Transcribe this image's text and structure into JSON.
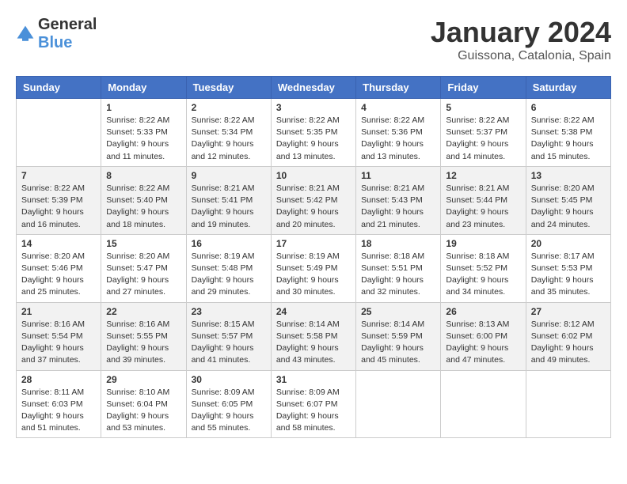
{
  "logo": {
    "text_general": "General",
    "text_blue": "Blue"
  },
  "title": "January 2024",
  "subtitle": "Guissona, Catalonia, Spain",
  "weekdays": [
    "Sunday",
    "Monday",
    "Tuesday",
    "Wednesday",
    "Thursday",
    "Friday",
    "Saturday"
  ],
  "weeks": [
    [
      {
        "day": "",
        "sunrise": "",
        "sunset": "",
        "daylight": ""
      },
      {
        "day": "1",
        "sunrise": "Sunrise: 8:22 AM",
        "sunset": "Sunset: 5:33 PM",
        "daylight": "Daylight: 9 hours and 11 minutes."
      },
      {
        "day": "2",
        "sunrise": "Sunrise: 8:22 AM",
        "sunset": "Sunset: 5:34 PM",
        "daylight": "Daylight: 9 hours and 12 minutes."
      },
      {
        "day": "3",
        "sunrise": "Sunrise: 8:22 AM",
        "sunset": "Sunset: 5:35 PM",
        "daylight": "Daylight: 9 hours and 13 minutes."
      },
      {
        "day": "4",
        "sunrise": "Sunrise: 8:22 AM",
        "sunset": "Sunset: 5:36 PM",
        "daylight": "Daylight: 9 hours and 13 minutes."
      },
      {
        "day": "5",
        "sunrise": "Sunrise: 8:22 AM",
        "sunset": "Sunset: 5:37 PM",
        "daylight": "Daylight: 9 hours and 14 minutes."
      },
      {
        "day": "6",
        "sunrise": "Sunrise: 8:22 AM",
        "sunset": "Sunset: 5:38 PM",
        "daylight": "Daylight: 9 hours and 15 minutes."
      }
    ],
    [
      {
        "day": "7",
        "sunrise": "Sunrise: 8:22 AM",
        "sunset": "Sunset: 5:39 PM",
        "daylight": "Daylight: 9 hours and 16 minutes."
      },
      {
        "day": "8",
        "sunrise": "Sunrise: 8:22 AM",
        "sunset": "Sunset: 5:40 PM",
        "daylight": "Daylight: 9 hours and 18 minutes."
      },
      {
        "day": "9",
        "sunrise": "Sunrise: 8:21 AM",
        "sunset": "Sunset: 5:41 PM",
        "daylight": "Daylight: 9 hours and 19 minutes."
      },
      {
        "day": "10",
        "sunrise": "Sunrise: 8:21 AM",
        "sunset": "Sunset: 5:42 PM",
        "daylight": "Daylight: 9 hours and 20 minutes."
      },
      {
        "day": "11",
        "sunrise": "Sunrise: 8:21 AM",
        "sunset": "Sunset: 5:43 PM",
        "daylight": "Daylight: 9 hours and 21 minutes."
      },
      {
        "day": "12",
        "sunrise": "Sunrise: 8:21 AM",
        "sunset": "Sunset: 5:44 PM",
        "daylight": "Daylight: 9 hours and 23 minutes."
      },
      {
        "day": "13",
        "sunrise": "Sunrise: 8:20 AM",
        "sunset": "Sunset: 5:45 PM",
        "daylight": "Daylight: 9 hours and 24 minutes."
      }
    ],
    [
      {
        "day": "14",
        "sunrise": "Sunrise: 8:20 AM",
        "sunset": "Sunset: 5:46 PM",
        "daylight": "Daylight: 9 hours and 25 minutes."
      },
      {
        "day": "15",
        "sunrise": "Sunrise: 8:20 AM",
        "sunset": "Sunset: 5:47 PM",
        "daylight": "Daylight: 9 hours and 27 minutes."
      },
      {
        "day": "16",
        "sunrise": "Sunrise: 8:19 AM",
        "sunset": "Sunset: 5:48 PM",
        "daylight": "Daylight: 9 hours and 29 minutes."
      },
      {
        "day": "17",
        "sunrise": "Sunrise: 8:19 AM",
        "sunset": "Sunset: 5:49 PM",
        "daylight": "Daylight: 9 hours and 30 minutes."
      },
      {
        "day": "18",
        "sunrise": "Sunrise: 8:18 AM",
        "sunset": "Sunset: 5:51 PM",
        "daylight": "Daylight: 9 hours and 32 minutes."
      },
      {
        "day": "19",
        "sunrise": "Sunrise: 8:18 AM",
        "sunset": "Sunset: 5:52 PM",
        "daylight": "Daylight: 9 hours and 34 minutes."
      },
      {
        "day": "20",
        "sunrise": "Sunrise: 8:17 AM",
        "sunset": "Sunset: 5:53 PM",
        "daylight": "Daylight: 9 hours and 35 minutes."
      }
    ],
    [
      {
        "day": "21",
        "sunrise": "Sunrise: 8:16 AM",
        "sunset": "Sunset: 5:54 PM",
        "daylight": "Daylight: 9 hours and 37 minutes."
      },
      {
        "day": "22",
        "sunrise": "Sunrise: 8:16 AM",
        "sunset": "Sunset: 5:55 PM",
        "daylight": "Daylight: 9 hours and 39 minutes."
      },
      {
        "day": "23",
        "sunrise": "Sunrise: 8:15 AM",
        "sunset": "Sunset: 5:57 PM",
        "daylight": "Daylight: 9 hours and 41 minutes."
      },
      {
        "day": "24",
        "sunrise": "Sunrise: 8:14 AM",
        "sunset": "Sunset: 5:58 PM",
        "daylight": "Daylight: 9 hours and 43 minutes."
      },
      {
        "day": "25",
        "sunrise": "Sunrise: 8:14 AM",
        "sunset": "Sunset: 5:59 PM",
        "daylight": "Daylight: 9 hours and 45 minutes."
      },
      {
        "day": "26",
        "sunrise": "Sunrise: 8:13 AM",
        "sunset": "Sunset: 6:00 PM",
        "daylight": "Daylight: 9 hours and 47 minutes."
      },
      {
        "day": "27",
        "sunrise": "Sunrise: 8:12 AM",
        "sunset": "Sunset: 6:02 PM",
        "daylight": "Daylight: 9 hours and 49 minutes."
      }
    ],
    [
      {
        "day": "28",
        "sunrise": "Sunrise: 8:11 AM",
        "sunset": "Sunset: 6:03 PM",
        "daylight": "Daylight: 9 hours and 51 minutes."
      },
      {
        "day": "29",
        "sunrise": "Sunrise: 8:10 AM",
        "sunset": "Sunset: 6:04 PM",
        "daylight": "Daylight: 9 hours and 53 minutes."
      },
      {
        "day": "30",
        "sunrise": "Sunrise: 8:09 AM",
        "sunset": "Sunset: 6:05 PM",
        "daylight": "Daylight: 9 hours and 55 minutes."
      },
      {
        "day": "31",
        "sunrise": "Sunrise: 8:09 AM",
        "sunset": "Sunset: 6:07 PM",
        "daylight": "Daylight: 9 hours and 58 minutes."
      },
      {
        "day": "",
        "sunrise": "",
        "sunset": "",
        "daylight": ""
      },
      {
        "day": "",
        "sunrise": "",
        "sunset": "",
        "daylight": ""
      },
      {
        "day": "",
        "sunrise": "",
        "sunset": "",
        "daylight": ""
      }
    ]
  ]
}
